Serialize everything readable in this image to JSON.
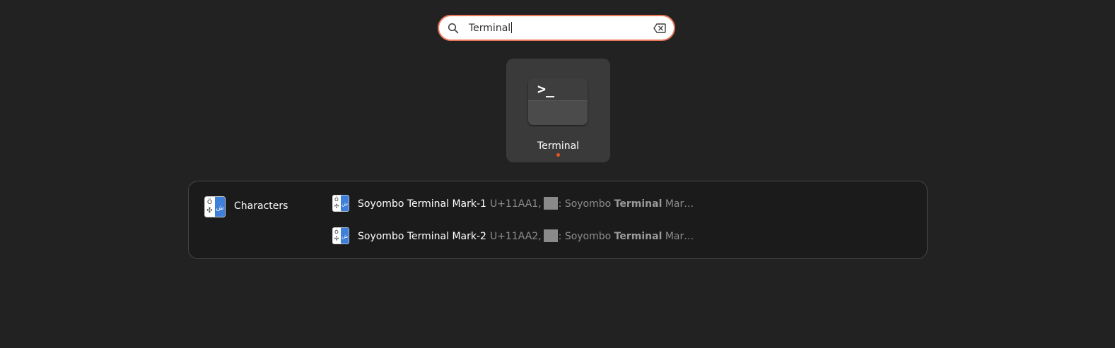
{
  "search": {
    "value": "Terminal",
    "icon": "search-icon",
    "clear_icon": "clear-text-icon",
    "accent_color": "#e8775a"
  },
  "app_result": {
    "label": "Terminal",
    "icon": "terminal-icon",
    "icon_text": ">_",
    "running_indicator_color": "#e95420"
  },
  "provider": {
    "title": "Characters",
    "icon": "characters-app-icon",
    "results": [
      {
        "name": "Soyombo Terminal Mark-1",
        "desc_prefix": "U+11AA1,",
        "desc_middle": ": Soyombo",
        "desc_bold": "Terminal",
        "desc_suffix": "Mar…"
      },
      {
        "name": "Soyombo Terminal Mark-2",
        "desc_prefix": "U+11AA2,",
        "desc_middle": ": Soyombo",
        "desc_bold": "Terminal",
        "desc_suffix": "Mar…"
      }
    ]
  }
}
